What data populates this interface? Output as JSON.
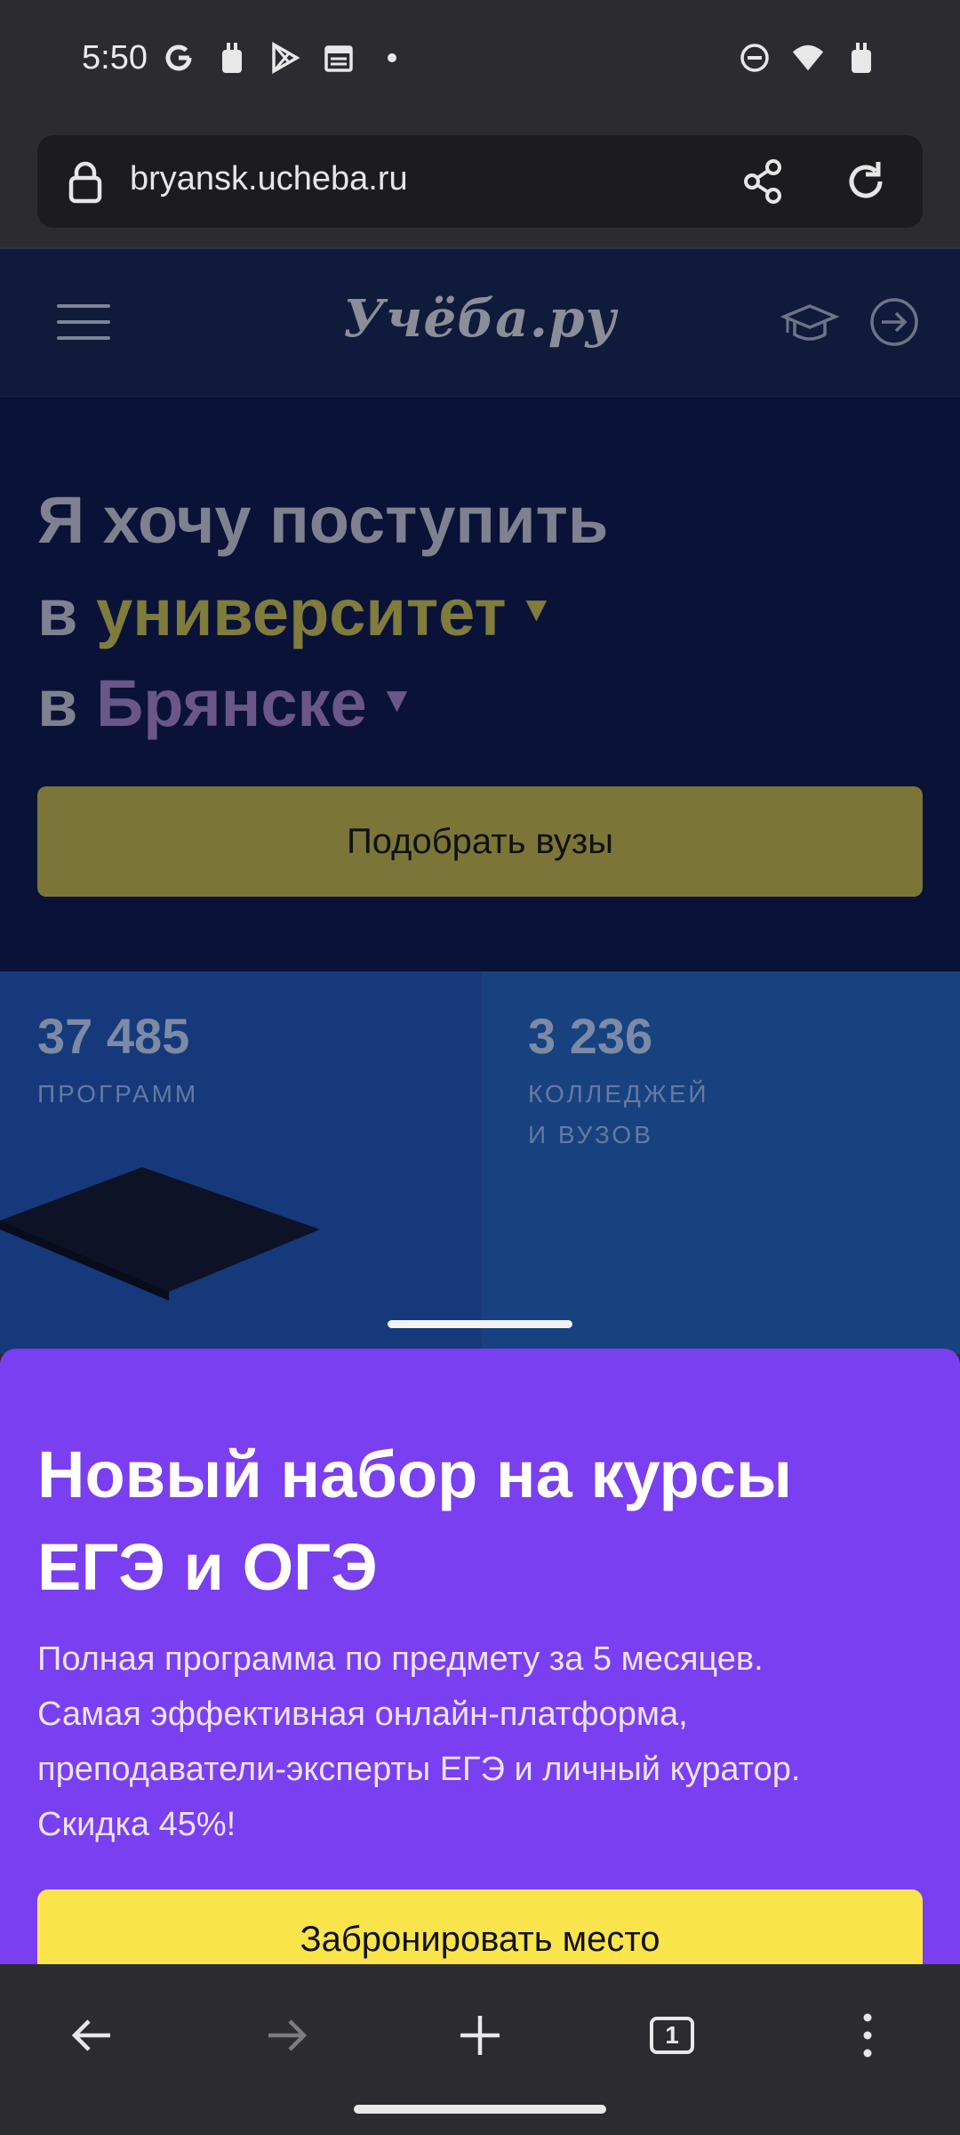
{
  "status_bar": {
    "time": "5:50",
    "left_icons": [
      "google-icon",
      "usb-debug-icon",
      "play-store-icon",
      "calendar-icon",
      "dot-icon"
    ],
    "right_icons": [
      "dnd-icon",
      "wifi-icon",
      "battery-icon"
    ]
  },
  "browser": {
    "url": "bryansk.ucheba.ru",
    "tabs_count": "1"
  },
  "site_header": {
    "logo": "Учёба.ру"
  },
  "hero": {
    "line1": "Я хочу поступить",
    "line2_prefix": "в",
    "line2_value": "университет",
    "line3_prefix": "в",
    "line3_value": "Брянске",
    "button": "Подобрать вузы"
  },
  "stats": [
    {
      "value": "37 485",
      "label": "ПРОГРАММ"
    },
    {
      "value": "3 236",
      "label_line1": "КОЛЛЕДЖЕЙ",
      "label_line2": "И ВУЗОВ"
    }
  ],
  "promo": {
    "title_line1": "Новый набор на курсы",
    "title_line2": "ЕГЭ и ОГЭ",
    "desc_line1": "Полная программа по предмету за 5 месяцев.",
    "desc_line2": "Самая эффективная онлайн-платформа,",
    "desc_line3": "преподаватели-эксперты ЕГЭ и личный куратор.",
    "desc_line4": "Скидка 45%!",
    "button": "Забронировать место"
  },
  "colors": {
    "promo_bg": "#7a3ff0",
    "promo_button": "#f9e44c",
    "hero_bg": "#0a1238",
    "select_button": "#7b7638"
  }
}
